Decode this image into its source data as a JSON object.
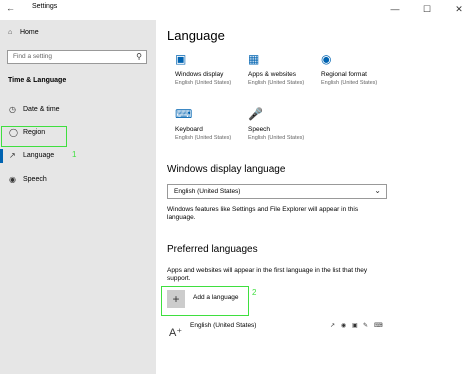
{
  "window": {
    "title": "Settings",
    "back_icon": "back-arrow-icon",
    "minimize_glyph": "—",
    "maximize_glyph": "☐",
    "close_glyph": "✕"
  },
  "sidebar": {
    "home_label": "Home",
    "search_placeholder": "Find a setting",
    "section_label": "Time & Language",
    "items": [
      {
        "label": "Date & time",
        "icon": "calendar-clock-icon"
      },
      {
        "label": "Region",
        "icon": "globe-icon"
      },
      {
        "label": "Language",
        "icon": "language-icon"
      },
      {
        "label": "Speech",
        "icon": "microphone-icon"
      }
    ],
    "active_item": "Language",
    "accent_color": "#0063b1"
  },
  "main": {
    "title": "Language",
    "tiles": [
      {
        "title": "Windows display",
        "subtitle": "English (United States)",
        "icon": "monitor-icon"
      },
      {
        "title": "Apps & websites",
        "subtitle": "English (United States)",
        "icon": "apps-icon"
      },
      {
        "title": "Regional format",
        "subtitle": "English (United States)",
        "icon": "regional-format-icon"
      },
      {
        "title": "Keyboard",
        "subtitle": "English (United States)",
        "icon": "keyboard-icon"
      },
      {
        "title": "Speech",
        "subtitle": "English (United States)",
        "icon": "microphone-icon"
      }
    ],
    "display_language": {
      "heading": "Windows display language",
      "selected": "English (United States)",
      "description": "Windows features like Settings and File Explorer will appear in this language."
    },
    "preferred": {
      "heading": "Preferred languages",
      "description": "Apps and websites will appear in the first language in the list that they support.",
      "add_label": "Add a language",
      "add_glyph": "+",
      "languages": [
        {
          "label": "English (United States)",
          "icon": "language-font-icon",
          "features": [
            "display-language-icon",
            "speech-icon",
            "voice-icon",
            "handwriting-icon",
            "keyboard-icon"
          ]
        }
      ]
    }
  },
  "annotations": {
    "step1": "1",
    "step2": "2",
    "color": "#3fdf3f"
  }
}
